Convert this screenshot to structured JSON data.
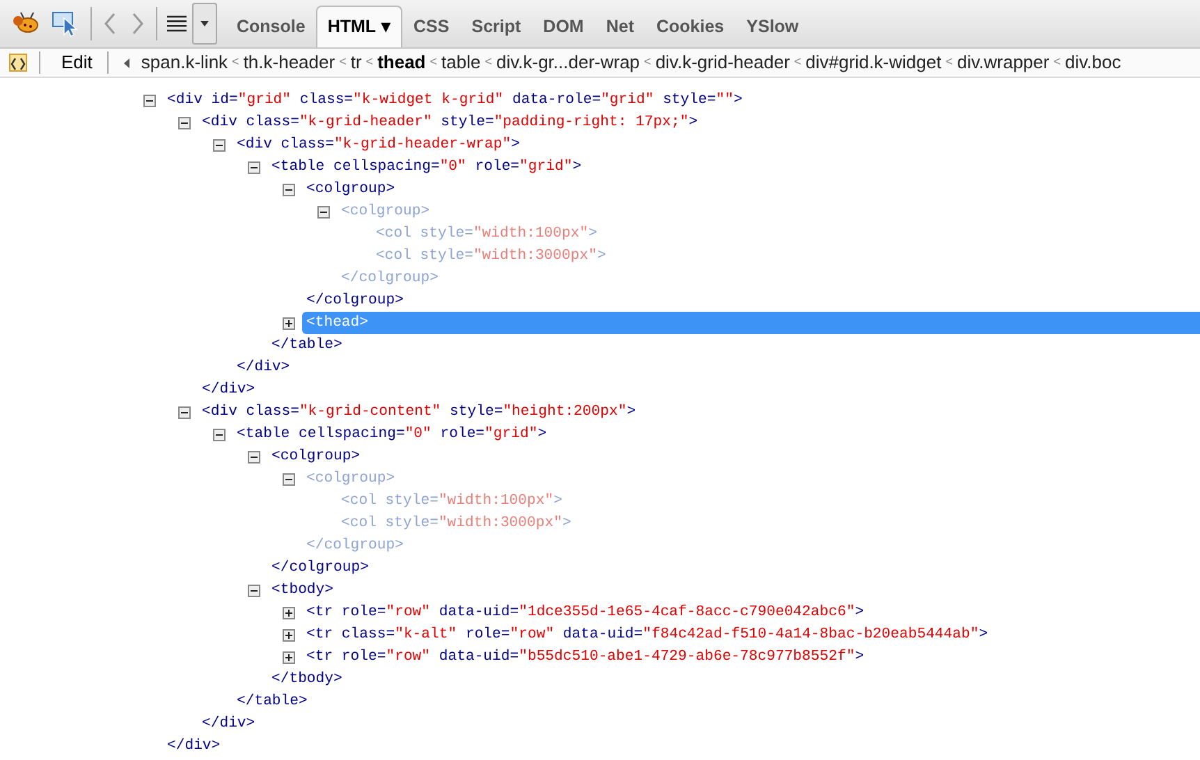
{
  "toolbar": {
    "tabs": [
      {
        "label": "Console",
        "selected": false
      },
      {
        "label": "HTML",
        "selected": true,
        "caret": "▾"
      },
      {
        "label": "CSS",
        "selected": false
      },
      {
        "label": "Script",
        "selected": false
      },
      {
        "label": "DOM",
        "selected": false
      },
      {
        "label": "Net",
        "selected": false
      },
      {
        "label": "Cookies",
        "selected": false
      },
      {
        "label": "YSlow",
        "selected": false
      }
    ]
  },
  "breadcrumbs": {
    "edit": "Edit",
    "items": [
      {
        "label": "span.k-link",
        "selected": false
      },
      {
        "sep": "<",
        "label": "th.k-header",
        "selected": false
      },
      {
        "sep": "<",
        "label": "tr",
        "selected": false
      },
      {
        "sep": "<",
        "label": "thead",
        "selected": true
      },
      {
        "sep": "<",
        "label": "table",
        "selected": false
      },
      {
        "sep": "<",
        "label": "div.k-gr...der-wrap",
        "selected": false
      },
      {
        "sep": "<",
        "label": "div.k-grid-header",
        "selected": false
      },
      {
        "sep": "<",
        "label": "div#grid.k-widget",
        "selected": false
      },
      {
        "sep": "<",
        "label": "div.wrapper",
        "selected": false
      },
      {
        "sep": "<",
        "label": "div.boc",
        "selected": false
      }
    ]
  },
  "tree": [
    {
      "tag": "<div",
      "attrs": [
        {
          "name": "id=",
          "value": "\"grid\""
        },
        {
          "name": "class=",
          "value": "\"k-widget k-grid\""
        },
        {
          "name": "data-role=",
          "value": "\"grid\""
        },
        {
          "name": "style=",
          "value": "\"\""
        }
      ],
      "end": ">",
      "expanded": true,
      "selected": false,
      "faded": false,
      "close": "</div>",
      "children": [
        {
          "tag": "<div",
          "attrs": [
            {
              "name": "class=",
              "value": "\"k-grid-header\""
            },
            {
              "name": "style=",
              "value": "\"padding-right: 17px;\""
            }
          ],
          "end": ">",
          "expanded": true,
          "selected": false,
          "faded": false,
          "close": "</div>",
          "children": [
            {
              "tag": "<div",
              "attrs": [
                {
                  "name": "class=",
                  "value": "\"k-grid-header-wrap\""
                }
              ],
              "end": ">",
              "expanded": true,
              "selected": false,
              "faded": false,
              "close": "</div>",
              "children": [
                {
                  "tag": "<table",
                  "attrs": [
                    {
                      "name": "cellspacing=",
                      "value": "\"0\""
                    },
                    {
                      "name": "role=",
                      "value": "\"grid\""
                    }
                  ],
                  "end": ">",
                  "expanded": true,
                  "selected": false,
                  "faded": false,
                  "close": "</table>",
                  "children": [
                    {
                      "tag": "<colgroup",
                      "end": ">",
                      "expanded": true,
                      "selected": false,
                      "faded": false,
                      "close": "</colgroup>",
                      "children": [
                        {
                          "tag": "<colgroup",
                          "end": ">",
                          "expanded": true,
                          "selected": false,
                          "faded": true,
                          "close": "</colgroup>",
                          "children": [
                            {
                              "tag": "<col",
                              "attrs": [
                                {
                                  "name": "style=",
                                  "value": "\"width:100px\""
                                }
                              ],
                              "end": ">",
                              "selected": false,
                              "faded": true
                            },
                            {
                              "tag": "<col",
                              "attrs": [
                                {
                                  "name": "style=",
                                  "value": "\"width:3000px\""
                                }
                              ],
                              "end": ">",
                              "selected": false,
                              "faded": true
                            }
                          ]
                        }
                      ]
                    },
                    {
                      "tag": "<thead",
                      "end": ">",
                      "expanded": false,
                      "selected": true,
                      "faded": false
                    }
                  ]
                }
              ]
            }
          ]
        },
        {
          "tag": "<div",
          "attrs": [
            {
              "name": "class=",
              "value": "\"k-grid-content\""
            },
            {
              "name": "style=",
              "value": "\"height:200px\""
            }
          ],
          "end": ">",
          "expanded": true,
          "selected": false,
          "faded": false,
          "close": "</div>",
          "children": [
            {
              "tag": "<table",
              "attrs": [
                {
                  "name": "cellspacing=",
                  "value": "\"0\""
                },
                {
                  "name": "role=",
                  "value": "\"grid\""
                }
              ],
              "end": ">",
              "expanded": true,
              "selected": false,
              "faded": false,
              "close": "</table>",
              "children": [
                {
                  "tag": "<colgroup",
                  "end": ">",
                  "expanded": true,
                  "selected": false,
                  "faded": false,
                  "close": "</colgroup>",
                  "children": [
                    {
                      "tag": "<colgroup",
                      "end": ">",
                      "expanded": true,
                      "selected": false,
                      "faded": true,
                      "close": "</colgroup>",
                      "children": [
                        {
                          "tag": "<col",
                          "attrs": [
                            {
                              "name": "style=",
                              "value": "\"width:100px\""
                            }
                          ],
                          "end": ">",
                          "selected": false,
                          "faded": true
                        },
                        {
                          "tag": "<col",
                          "attrs": [
                            {
                              "name": "style=",
                              "value": "\"width:3000px\""
                            }
                          ],
                          "end": ">",
                          "selected": false,
                          "faded": true
                        }
                      ]
                    }
                  ]
                },
                {
                  "tag": "<tbody",
                  "end": ">",
                  "expanded": true,
                  "selected": false,
                  "faded": false,
                  "close": "</tbody>",
                  "children": [
                    {
                      "tag": "<tr",
                      "attrs": [
                        {
                          "name": "role=",
                          "value": "\"row\""
                        },
                        {
                          "name": "data-uid=",
                          "value": "\"1dce355d-1e65-4caf-8acc-c790e042abc6\""
                        }
                      ],
                      "end": ">",
                      "expanded": false,
                      "selected": false,
                      "faded": false
                    },
                    {
                      "tag": "<tr",
                      "attrs": [
                        {
                          "name": "class=",
                          "value": "\"k-alt\""
                        },
                        {
                          "name": "role=",
                          "value": "\"row\""
                        },
                        {
                          "name": "data-uid=",
                          "value": "\"f84c42ad-f510-4a14-8bac-b20eab5444ab\""
                        }
                      ],
                      "end": ">",
                      "expanded": false,
                      "selected": false,
                      "faded": false
                    },
                    {
                      "tag": "<tr",
                      "attrs": [
                        {
                          "name": "role=",
                          "value": "\"row\""
                        },
                        {
                          "name": "data-uid=",
                          "value": "\"b55dc510-abe1-4729-ab6e-78c977b8552f\""
                        }
                      ],
                      "end": ">",
                      "expanded": false,
                      "selected": false,
                      "faded": false
                    }
                  ]
                }
              ]
            }
          ]
        }
      ]
    }
  ]
}
